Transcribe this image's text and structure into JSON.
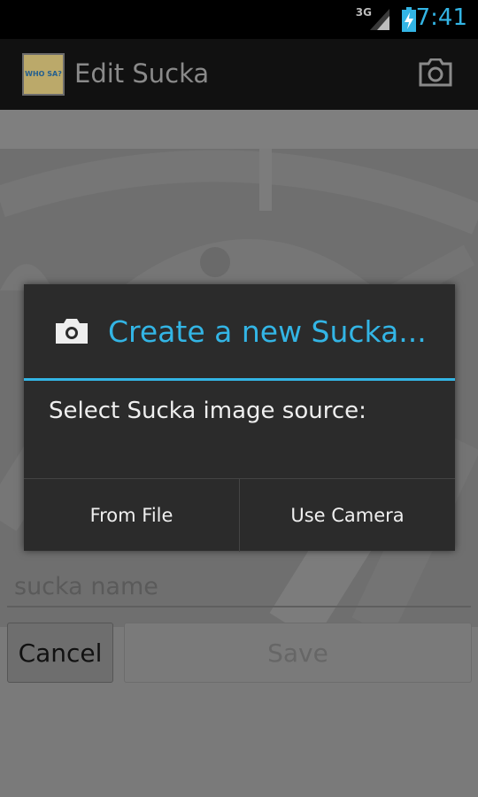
{
  "status_bar": {
    "network": "3G",
    "time": "7:41",
    "clock_color": "#33b5e5"
  },
  "action_bar": {
    "logo_text": "WHO SA?",
    "title": "Edit Sucka",
    "camera_icon": "camera-icon"
  },
  "dialog": {
    "icon": "camera-icon",
    "title": "Create a new Sucka...",
    "message": "Select Sucka image source:",
    "buttons": {
      "from_file": "From File",
      "use_camera": "Use Camera"
    },
    "accent_color": "#33b5e5"
  },
  "form": {
    "name_placeholder": "sucka name",
    "name_value": "",
    "cancel_label": "Cancel",
    "save_label": "Save"
  }
}
